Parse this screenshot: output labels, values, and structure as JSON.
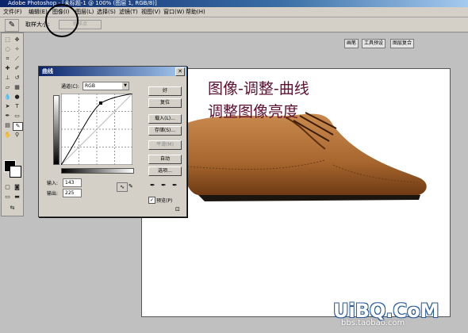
{
  "window": {
    "title": "Adobe Photoshop - [未标题-1 @ 100% (图层 1, RGB/8)]"
  },
  "menu": [
    "文件(F)",
    "编辑(E)",
    "图像(I)",
    "图层(L)",
    "选择(S)",
    "滤镜(T)",
    "视图(V)",
    "窗口(W)",
    "帮助(H)"
  ],
  "options": {
    "label": "取样大小:",
    "value": "取样点"
  },
  "wells": [
    "画笔",
    "工具预设",
    "图层复合"
  ],
  "caption": {
    "line1": "图像-调整-曲线",
    "line2": "调整图像亮度"
  },
  "dialog": {
    "title": "曲线",
    "channel_label": "通道(C):",
    "channel_value": "RGB",
    "input_label": "输入:",
    "input_value": "143",
    "output_label": "输出:",
    "output_value": "225",
    "buttons": {
      "ok": "好",
      "reset": "复位",
      "load": "载入(L)...",
      "save": "存储(S)...",
      "smooth": "平滑(M)",
      "auto": "自动",
      "options": "选项..."
    },
    "preview_label": "预览(P)",
    "preview_checked": true
  },
  "watermark": {
    "main": "UiBQ.CoM",
    "sub": "bbs.taobao.com"
  }
}
